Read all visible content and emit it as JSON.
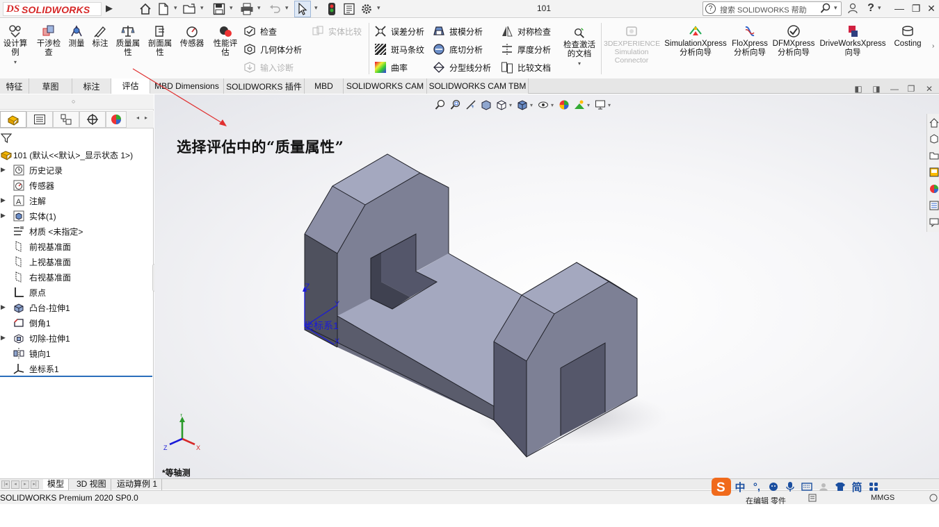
{
  "titlebar": {
    "logo_ds": "DS",
    "logo_text": "SOLIDWORKS",
    "document_title": "101",
    "search_placeholder": "搜索 SOLIDWORKS 帮助",
    "help_symbol": "?",
    "quick_access_icons": [
      "home-icon",
      "new-document-icon",
      "open-folder-icon",
      "save-icon",
      "print-icon",
      "undo-icon",
      "select-cursor-icon",
      "rebuild-traffic-light-icon",
      "file-properties-icon",
      "options-gear-icon"
    ],
    "window_buttons": [
      "minimize",
      "restore",
      "close"
    ]
  },
  "command_manager": {
    "big_tools": [
      {
        "label": "设计算例",
        "icon": "design-study-icon"
      },
      {
        "label": "干涉检查",
        "icon": "interference-check-icon"
      },
      {
        "label": "测量",
        "icon": "measure-icon"
      },
      {
        "label": "标注",
        "icon": "markup-icon"
      },
      {
        "label": "质量属性",
        "icon": "mass-properties-scale-icon"
      },
      {
        "label": "剖面属性",
        "icon": "section-properties-icon"
      },
      {
        "label": "传感器",
        "icon": "sensor-gauge-icon"
      },
      {
        "label": "性能评估",
        "icon": "performance-evaluation-icon"
      }
    ],
    "col1": [
      {
        "label": "检查",
        "icon": "check-icon",
        "enabled": true
      },
      {
        "label": "几何体分析",
        "icon": "geometry-analysis-icon",
        "enabled": true
      },
      {
        "label": "输入诊断",
        "icon": "import-diagnostics-icon",
        "enabled": false
      }
    ],
    "col_solid_compare": {
      "label": "实体比较",
      "icon": "body-compare-icon",
      "enabled": false
    },
    "col2": [
      {
        "label": "误差分析",
        "icon": "deviation-analysis-icon"
      },
      {
        "label": "斑马条纹",
        "icon": "zebra-stripes-icon"
      },
      {
        "label": "曲率",
        "icon": "curvature-icon"
      }
    ],
    "col3": [
      {
        "label": "拔模分析",
        "icon": "draft-analysis-icon"
      },
      {
        "label": "底切分析",
        "icon": "undercut-analysis-icon"
      },
      {
        "label": "分型线分析",
        "icon": "parting-line-analysis-icon"
      }
    ],
    "col4": [
      {
        "label": "对称检查",
        "icon": "symmetry-check-icon"
      },
      {
        "label": "厚度分析",
        "icon": "thickness-analysis-icon"
      },
      {
        "label": "比较文档",
        "icon": "compare-documents-icon"
      }
    ],
    "check_active_doc": {
      "label_line1": "检查激活",
      "label_line2": "的文档",
      "icon": "check-active-document-icon"
    },
    "right_tools": [
      {
        "line1": "3DEXPERIENCE",
        "line2": "Simulation",
        "line3": "Connector",
        "icon": "3dexperience-icon",
        "enabled": false
      },
      {
        "line1": "SimulationXpress",
        "line2": "分析向导",
        "icon": "simulationxpress-icon",
        "enabled": true
      },
      {
        "line1": "FloXpress",
        "line2": "分析向导",
        "icon": "floxpress-icon",
        "enabled": true
      },
      {
        "line1": "DFMXpress",
        "line2": "分析向导",
        "icon": "dfmxpress-icon",
        "enabled": true
      },
      {
        "line1": "DriveWorksXpress",
        "line2": "向导",
        "icon": "driveworksxpress-icon",
        "enabled": true
      },
      {
        "line1": "Costing",
        "line2": "",
        "icon": "costing-icon",
        "enabled": true
      }
    ]
  },
  "tabs": [
    "特征",
    "草图",
    "标注",
    "评估",
    "MBD Dimensions",
    "SOLIDWORKS 插件",
    "MBD",
    "SOLIDWORKS CAM",
    "SOLIDWORKS CAM TBM"
  ],
  "active_tab": "评估",
  "feature_tree": {
    "root": "101  (默认<<默认>_显示状态 1>)",
    "items": [
      {
        "label": "历史记录",
        "icon": "history-icon",
        "expandable": true
      },
      {
        "label": "传感器",
        "icon": "sensors-icon",
        "expandable": false
      },
      {
        "label": "注解",
        "icon": "annotations-icon",
        "expandable": true
      },
      {
        "label": "实体(1)",
        "icon": "solid-bodies-icon",
        "expandable": true
      },
      {
        "label": "材质 <未指定>",
        "icon": "material-icon",
        "expandable": false
      },
      {
        "label": "前视基准面",
        "icon": "plane-icon",
        "expandable": false
      },
      {
        "label": "上视基准面",
        "icon": "plane-icon",
        "expandable": false
      },
      {
        "label": "右视基准面",
        "icon": "plane-icon",
        "expandable": false
      },
      {
        "label": "原点",
        "icon": "origin-icon",
        "expandable": false
      },
      {
        "label": "凸台-拉伸1",
        "icon": "boss-extrude-icon",
        "expandable": true
      },
      {
        "label": "倒角1",
        "icon": "chamfer-icon",
        "expandable": false
      },
      {
        "label": "切除-拉伸1",
        "icon": "cut-extrude-icon",
        "expandable": true
      },
      {
        "label": "镜向1",
        "icon": "mirror-icon",
        "expandable": false
      },
      {
        "label": "坐标系1",
        "icon": "coordinate-system-icon",
        "expandable": false
      }
    ]
  },
  "viewport": {
    "annotation": "选择评估中的“质量属性”",
    "coordinate_system_label": "坐标系1",
    "axis_labels": {
      "x": "X",
      "y": "Y",
      "z": "Z"
    },
    "view_orientation": "*等轴测"
  },
  "bottom_tabs": [
    "模型",
    "3D 视图",
    "运动算例 1"
  ],
  "active_bottom_tab": "模型",
  "status": {
    "product": "SOLIDWORKS Premium 2020 SP0.0",
    "editing": "在编辑 零件",
    "units": "MMGS"
  },
  "ime_bar": {
    "items": [
      "中",
      "°,",
      "☺",
      "🎤",
      "⌨",
      "👤",
      "👕",
      "简",
      "⁘"
    ]
  },
  "colors": {
    "accent_blue": "#2a6ebb",
    "logo_red": "#d62828",
    "model_top": "#a7abc2",
    "model_side": "#6e7083",
    "model_dark": "#50525f",
    "triad_blue": "#1a1ad8",
    "arrow_red": "#e03030"
  }
}
